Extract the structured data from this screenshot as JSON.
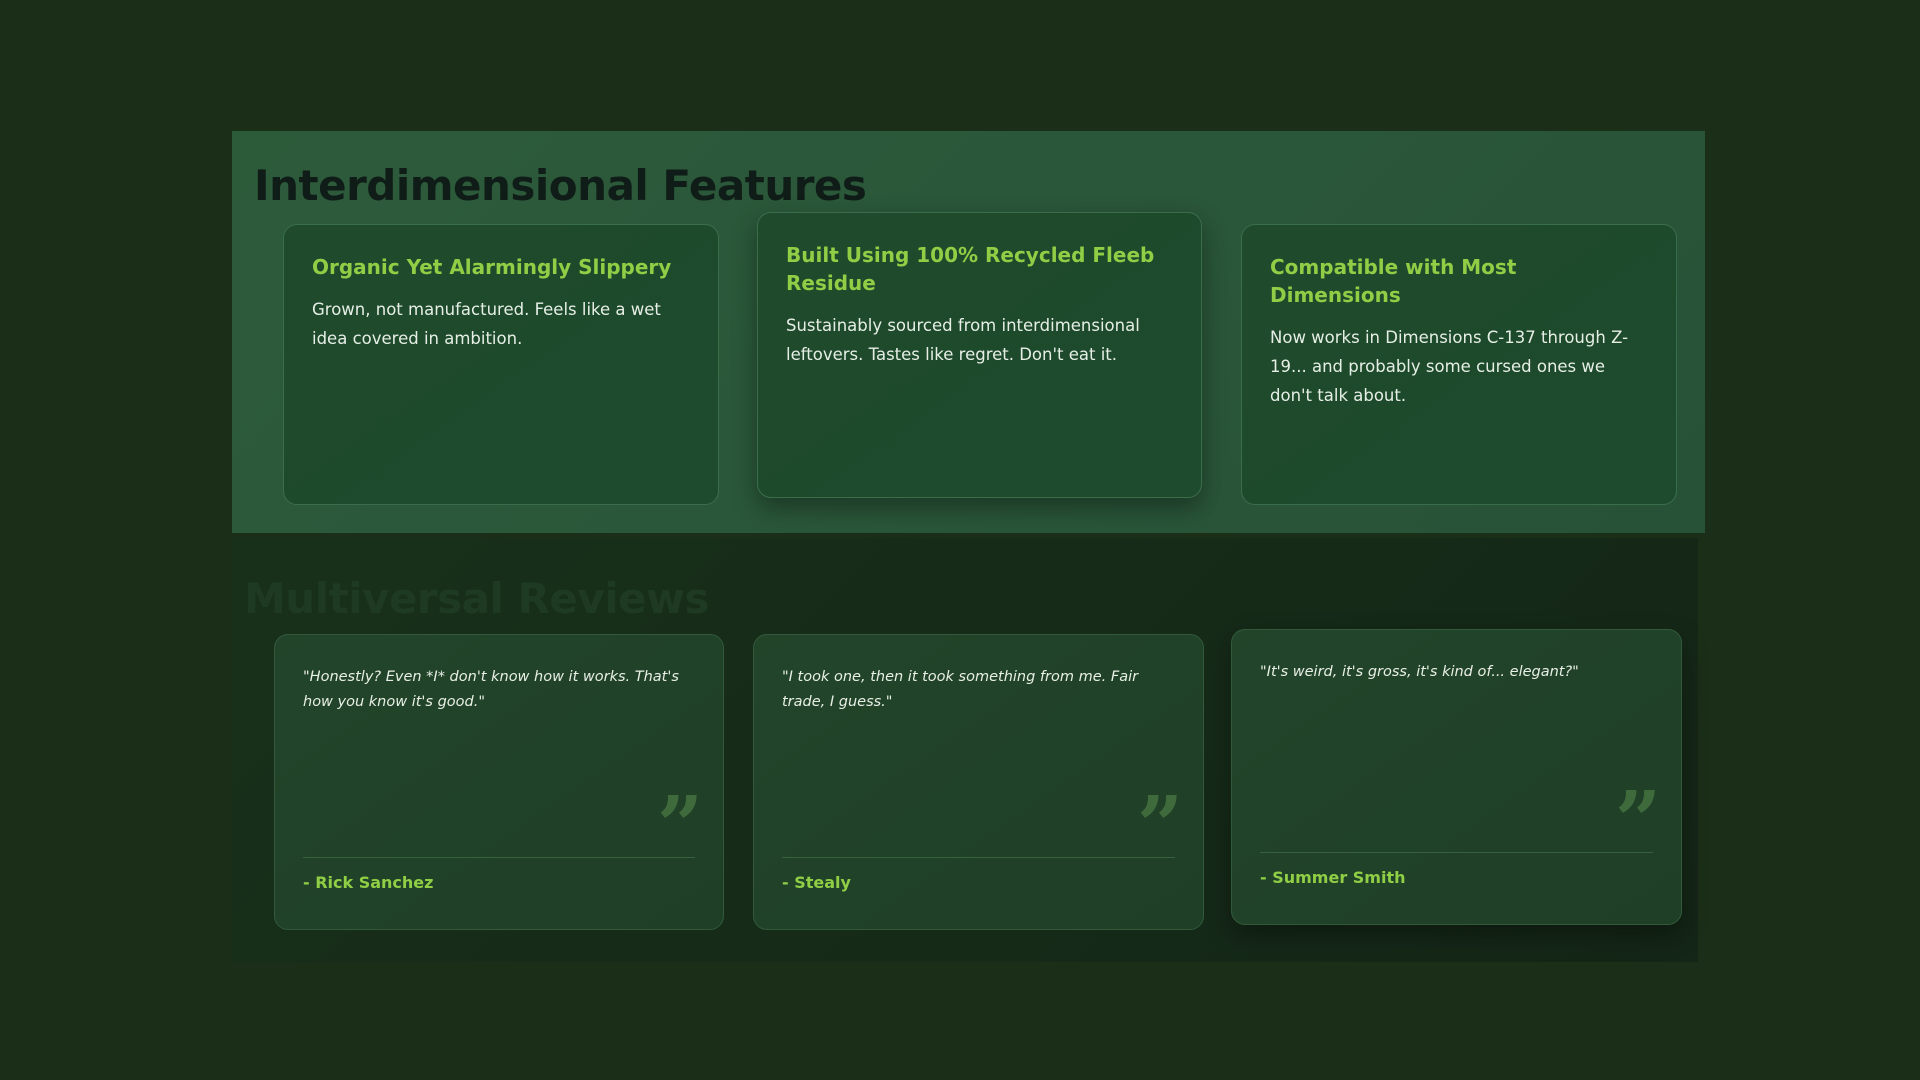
{
  "features": {
    "title": "Interdimensional Features",
    "cards": [
      {
        "title": "Organic Yet Alarmingly Slippery",
        "description": "Grown, not manufactured. Feels like a wet idea covered in ambition."
      },
      {
        "title": "Built Using 100% Recycled Fleeb Residue",
        "description": "Sustainably sourced from interdimensional leftovers. Tastes like regret. Don't eat it."
      },
      {
        "title": "Compatible with Most Dimensions",
        "description": "Now works in Dimensions C-137 through Z-19... and probably some cursed ones we don't talk about."
      }
    ]
  },
  "reviews": {
    "title": "Multiversal Reviews",
    "quote_mark": "”",
    "items": [
      {
        "quote": "\"Honestly? Even *I* don't know how it works. That's how you know it's good.\"",
        "author": "- Rick Sanchez"
      },
      {
        "quote": "\"I took one, then it took something from me. Fair trade, I guess.\"",
        "author": "- Stealy"
      },
      {
        "quote": "\"It's weird, it's gross, it's kind of... elegant?\"",
        "author": "- Summer Smith"
      }
    ]
  },
  "colors": {
    "background": "#1b2e18",
    "features_panel": "#2c5b3a",
    "accent": "#8fce45",
    "heading_dark": "#0f1c17"
  }
}
